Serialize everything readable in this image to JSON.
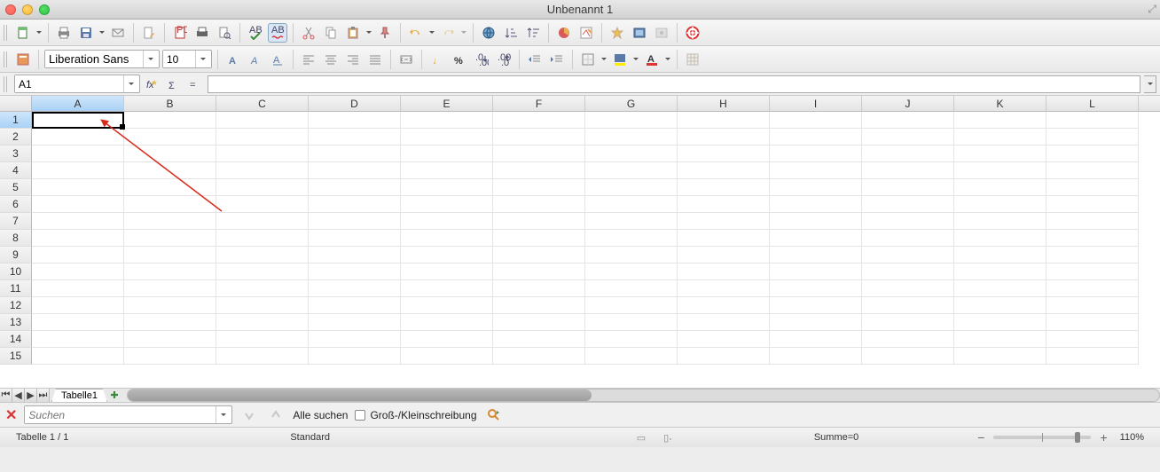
{
  "window": {
    "title": "Unbenannt 1"
  },
  "toolbar2": {
    "font_name": "Liberation Sans",
    "font_size": "10"
  },
  "formulabar": {
    "cell_ref": "A1",
    "formula": ""
  },
  "grid": {
    "columns": [
      "A",
      "B",
      "C",
      "D",
      "E",
      "F",
      "G",
      "H",
      "I",
      "J",
      "K",
      "L"
    ],
    "rows": [
      "1",
      "2",
      "3",
      "4",
      "5",
      "6",
      "7",
      "8",
      "9",
      "10",
      "11",
      "12",
      "13",
      "14",
      "15"
    ],
    "selected_col": "A",
    "selected_row": "1"
  },
  "sheetbar": {
    "tab": "Tabelle1"
  },
  "findbar": {
    "placeholder": "Suchen",
    "find_all": "Alle suchen",
    "match_case": "Groß-/Kleinschreibung"
  },
  "status": {
    "sheet_info": "Tabelle 1 / 1",
    "style": "Standard",
    "sum": "Summe=0",
    "zoom": "110%"
  }
}
